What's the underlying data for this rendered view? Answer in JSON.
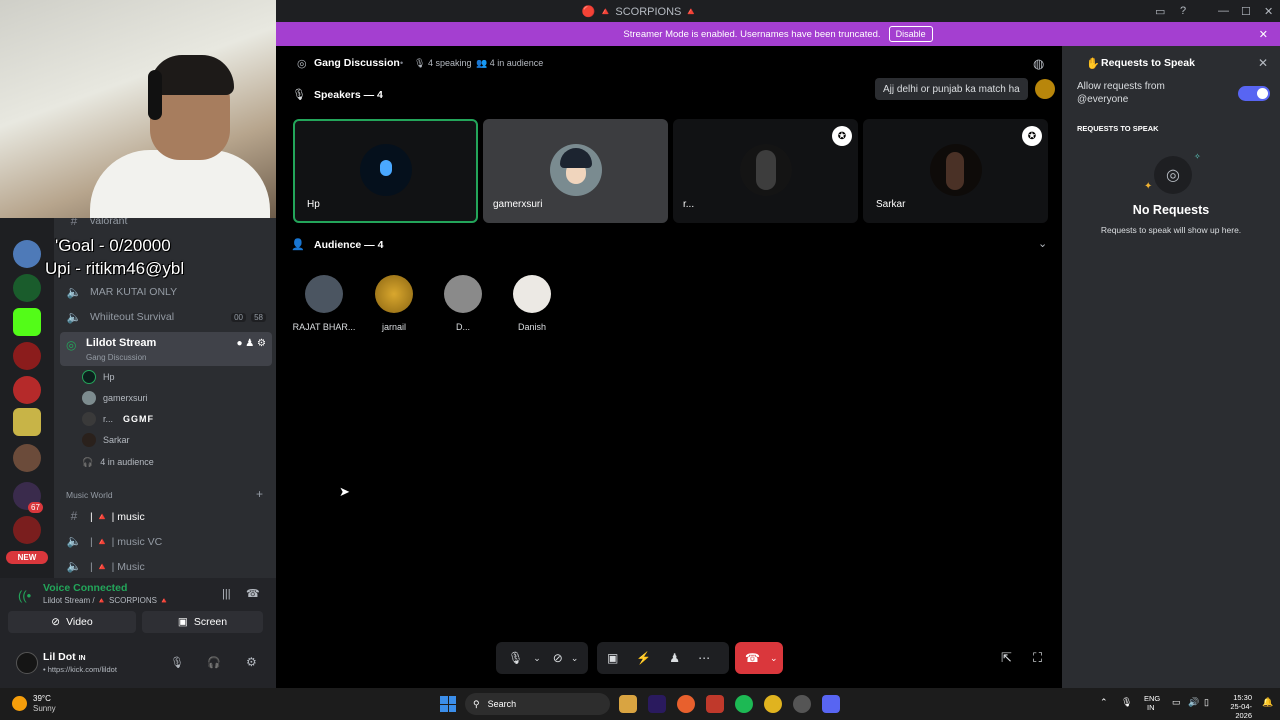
{
  "titlebar": {
    "title": "🔴 🔺 SCORPIONS 🔺"
  },
  "overlay": {
    "goal": "'Goal - 0/20000",
    "upi": "Upi - ritikm46@ybl",
    "partial_channel": "menu-8-banner",
    "partial_channel2": "custom-stick..."
  },
  "rail": {
    "mention_count": "67",
    "new_label": "NEW"
  },
  "channels": {
    "top_partial": "valorant",
    "items": [
      {
        "label": "MAR KUTAI ONLY"
      },
      {
        "label": "Whiiteout Survival",
        "count_a": "00",
        "count_b": "58"
      }
    ],
    "active": {
      "label": "Lildot Stream",
      "sublabel": "Gang Discussion"
    },
    "members": [
      {
        "name": "Hp"
      },
      {
        "name": "gamerxsuri"
      },
      {
        "name": "r...",
        "tag": "GGMF"
      },
      {
        "name": "Sarkar"
      }
    ],
    "audience_label": "4 in audience",
    "category": "Music World",
    "music_channels": [
      {
        "label": "| 🔺 | music"
      },
      {
        "label": "| 🔺 | music VC"
      },
      {
        "label": "| 🔺 | Music"
      }
    ]
  },
  "voice": {
    "status": "Voice Connected",
    "location": "Lildot Stream / 🔺 SCORPIONS 🔺",
    "video_label": "Video",
    "screen_label": "Screen"
  },
  "user": {
    "name": "Lil Dot",
    "tag": "IN",
    "status": "• https://kick.com/lildot"
  },
  "banner": {
    "text": "Streamer Mode is enabled. Usernames have been truncated.",
    "disable": "Disable"
  },
  "stage": {
    "title": "Gang Discussion",
    "speaking": "4 speaking",
    "audience": "4 in audience",
    "speakers_header": "Speakers — 4",
    "audience_header": "Audience — 4",
    "toast": "Ajj delhi or punjab ka match ha",
    "speakers": [
      {
        "name": "Hp"
      },
      {
        "name": "gamerxsuri"
      },
      {
        "name": "r..."
      },
      {
        "name": "Sarkar"
      }
    ],
    "audience_members": [
      {
        "name": "RAJAT BHAR..."
      },
      {
        "name": "jarnail"
      },
      {
        "name": "D..."
      },
      {
        "name": "Danish"
      }
    ]
  },
  "requests": {
    "title": "Requests to Speak",
    "allow_label": "Allow requests from @everyone",
    "section": "REQUESTS TO SPEAK",
    "empty_title": "No Requests",
    "empty_sub": "Requests to speak will show up here."
  },
  "taskbar": {
    "temp": "39°C",
    "weather": "Sunny",
    "search": "Search",
    "lang1": "ENG",
    "lang2": "IN",
    "time": "15:30",
    "date": "25-04-2026"
  },
  "colors": {
    "accent": "#5865f2",
    "banner": "#a43fd0",
    "green": "#23a55a",
    "danger": "#da373c"
  }
}
